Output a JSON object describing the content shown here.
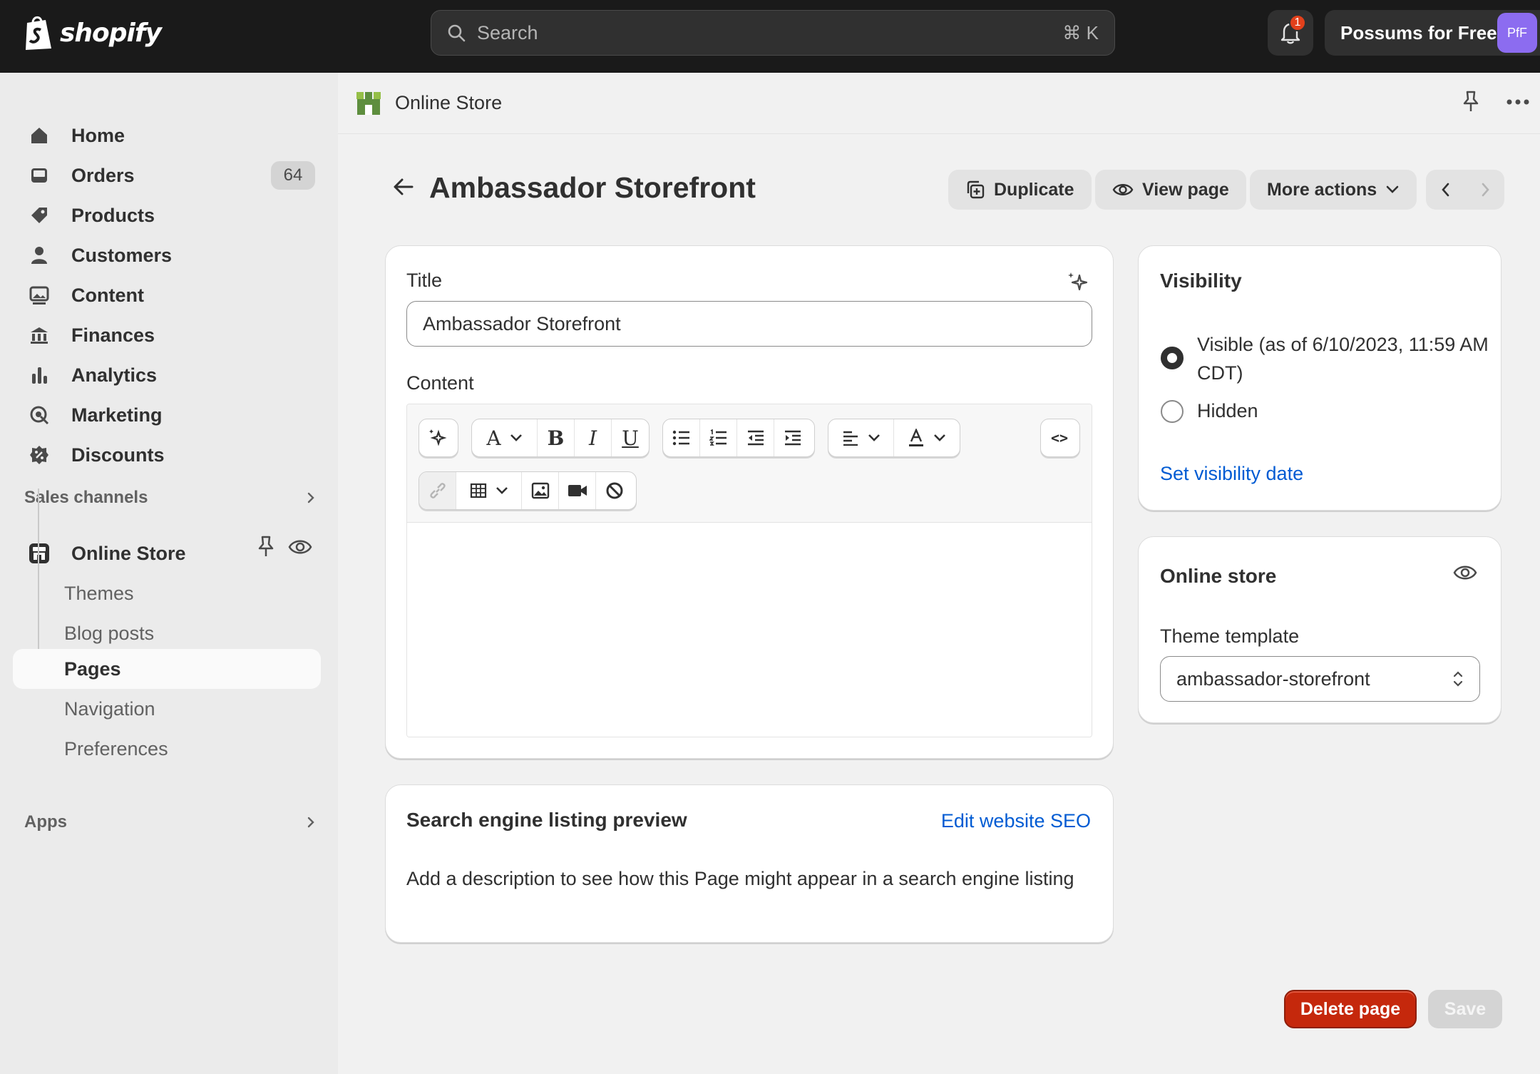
{
  "app": {
    "brand": "shopify",
    "search_placeholder": "Search",
    "search_shortcut": "⌘ K",
    "notification_count": "1",
    "store_name": "Possums for Free",
    "avatar_initials": "PfF"
  },
  "sidebar": {
    "items": [
      {
        "label": "Home",
        "icon": "home-icon"
      },
      {
        "label": "Orders",
        "icon": "inbox-icon",
        "count": "64"
      },
      {
        "label": "Products",
        "icon": "tag-icon"
      },
      {
        "label": "Customers",
        "icon": "person-icon"
      },
      {
        "label": "Content",
        "icon": "image-icon"
      },
      {
        "label": "Finances",
        "icon": "bank-icon"
      },
      {
        "label": "Analytics",
        "icon": "bar-chart-icon"
      },
      {
        "label": "Marketing",
        "icon": "target-icon"
      },
      {
        "label": "Discounts",
        "icon": "discount-icon"
      }
    ],
    "sales_channels_label": "Sales channels",
    "online_store_label": "Online Store",
    "sub_items": [
      "Themes",
      "Blog posts",
      "Pages",
      "Navigation",
      "Preferences"
    ],
    "active_sub_item": "Pages",
    "apps_label": "Apps"
  },
  "header": {
    "section_title": "Online Store"
  },
  "page": {
    "title": "Ambassador Storefront",
    "actions": {
      "duplicate": "Duplicate",
      "view_page": "View page",
      "more_actions": "More actions"
    }
  },
  "main_card": {
    "title_label": "Title",
    "title_value": "Ambassador Storefront",
    "content_label": "Content",
    "toolbar_buttons": [
      "magic",
      "font",
      "bold",
      "italic",
      "underline",
      "bullet-list",
      "numbered-list",
      "outdent",
      "indent",
      "align",
      "text-color",
      "source-code",
      "link",
      "table",
      "image",
      "video",
      "clear-format"
    ],
    "bold_glyph": "B",
    "italic_glyph": "I",
    "underline_glyph": "U",
    "font_glyph": "A",
    "code_glyph": "<>"
  },
  "seo_card": {
    "heading": "Search engine listing preview",
    "edit_link": "Edit website SEO",
    "description": "Add a description to see how this Page might appear in a search engine listing"
  },
  "visibility_card": {
    "heading": "Visibility",
    "options": [
      {
        "label": "Visible (as of 6/10/2023, 11:59 AM CDT)",
        "selected": true
      },
      {
        "label": "Hidden",
        "selected": false
      }
    ],
    "set_date_link": "Set visibility date"
  },
  "online_store_card": {
    "heading": "Online store",
    "template_label": "Theme template",
    "template_value": "ambassador-storefront"
  },
  "footer": {
    "delete_label": "Delete page",
    "save_label": "Save"
  },
  "colors": {
    "topbar": "#1a1a1a",
    "link": "#005bd3",
    "danger": "#c5280c",
    "avatar": "#8c6cf0",
    "badge": "#e2401b"
  }
}
